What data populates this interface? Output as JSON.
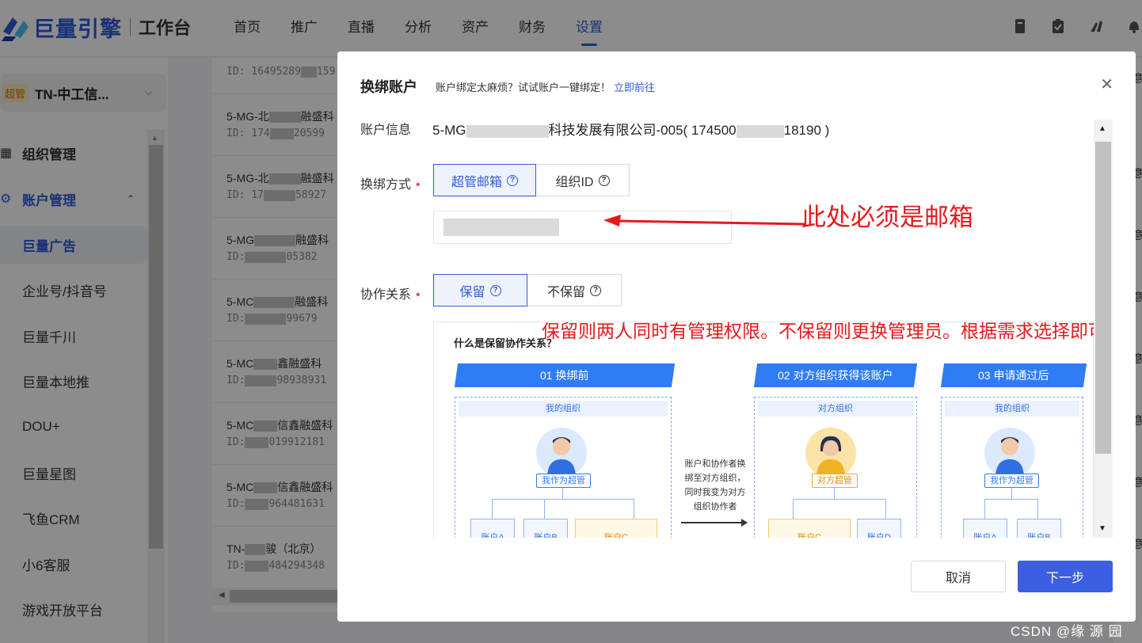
{
  "header": {
    "brand": "巨量引擎",
    "workspace": "工作台",
    "nav": [
      "首页",
      "推广",
      "直播",
      "分析",
      "资产",
      "财务",
      "设置"
    ],
    "active_nav": "设置"
  },
  "sidebar": {
    "org_badge": "超管",
    "org_name": "TN-中工信...",
    "groups": [
      {
        "label": "组织管理",
        "icon": "grid-icon"
      },
      {
        "label": "账户管理",
        "icon": "gear-icon"
      }
    ],
    "items": [
      "巨量广告",
      "企业号/抖音号",
      "巨量千川",
      "巨量本地推",
      "DOU+",
      "巨量星图",
      "飞鱼CRM",
      "小6客服",
      "游戏开放平台"
    ],
    "active_item": "巨量广告"
  },
  "background_list": [
    {
      "name": "",
      "id": "ID: 16495289",
      "id_tail": "159"
    },
    {
      "name": "5-MG-北",
      "name_tail": "融盛科",
      "id": "ID: 174",
      "id_tail": "20599"
    },
    {
      "name": "5-MG-北",
      "name_tail": "融盛科",
      "id": "ID: 17",
      "id_tail": "58927"
    },
    {
      "name": "5-MG",
      "name_tail": "融盛科",
      "id": "ID:",
      "id_tail": "05382"
    },
    {
      "name": "5-MC",
      "name_tail": "融盛科",
      "id": "ID:",
      "id_tail": "99679"
    },
    {
      "name": "5-MC",
      "name_tail": "鑫融盛科",
      "id": "ID:",
      "id_tail": "98938931"
    },
    {
      "name": "5-MC",
      "name_tail": "信鑫融盛科",
      "id": "ID:",
      "id_tail": "019912181"
    },
    {
      "name": "5-MC",
      "name_tail": "信鑫融盛科",
      "id": "ID:",
      "id_tail": "964481631"
    },
    {
      "name": "TN-",
      "name_tail": "骏（北京）",
      "id": "ID:",
      "id_tail": "484294348"
    }
  ],
  "right_edge_text": "意",
  "modal": {
    "title": "换绑账户",
    "tip": "账户绑定太麻烦？试试账户一键绑定！",
    "tip_link": "立即前往",
    "account_info_label": "账户信息",
    "account_info_prefix": "5-MG",
    "account_info_middle": "科技发展有限公司-005( 174500",
    "account_info_suffix": "18190 )",
    "rebind_label": "换绑方式",
    "rebind_options": [
      "超管邮箱",
      "组织ID"
    ],
    "rebind_selected": "超管邮箱",
    "coop_label": "协作关系",
    "coop_options": [
      "保留",
      "不保留"
    ],
    "coop_selected": "保留",
    "cancel": "取消",
    "next": "下一步"
  },
  "annotations": {
    "email_note": "此处必须是邮箱",
    "coop_note": "保留则两人同时有管理权限。不保留则更换管理员。根据需求选择即可"
  },
  "diagram": {
    "title": "什么是保留协作关系？",
    "steps": [
      "01 换绑前",
      "02 对方组织获得该账户",
      "03 申请通过后"
    ],
    "box_captions": [
      "我的组织",
      "对方组织",
      "我的组织"
    ],
    "tags": [
      "我作为超管",
      "对方超管",
      "我作为超管"
    ],
    "arrow_text": [
      "账户和协作者换",
      "绑至对方组织，",
      "同时我变为对方",
      "组织协作者"
    ],
    "accounts": [
      "账户A",
      "账户B",
      "账户C",
      "账户C",
      "账户D",
      "账户A",
      "账户B"
    ]
  },
  "watermark": "CSDN @缘  源  园",
  "colors": {
    "brand": "#2f5bd8",
    "primary_button": "#3b5fe0",
    "annotation": "#e6191d",
    "diagram_blue": "#2f7cf6"
  }
}
